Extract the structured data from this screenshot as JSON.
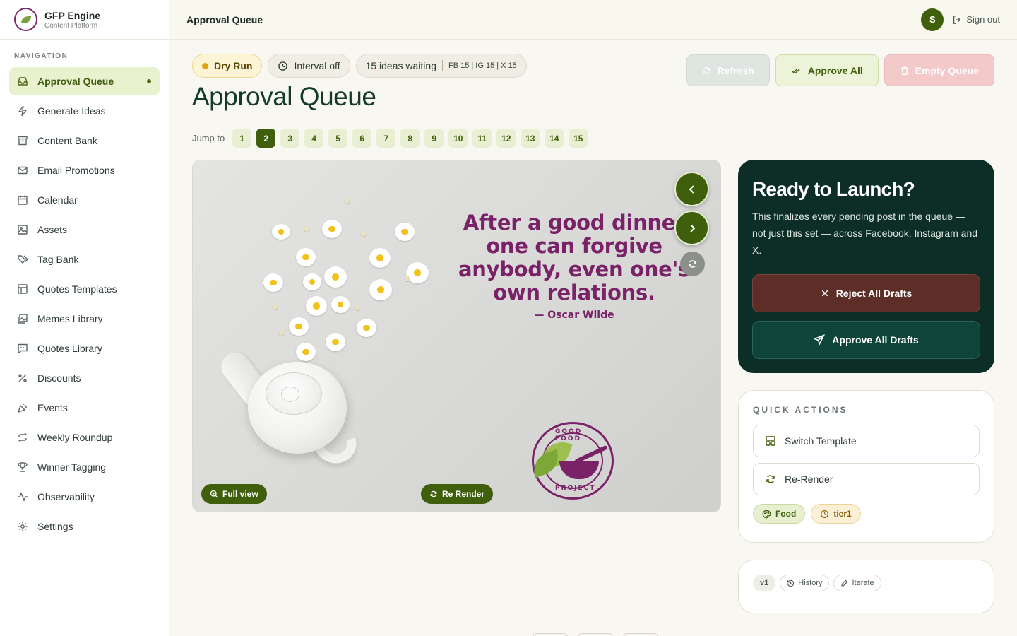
{
  "brand": {
    "name": "GFP Engine",
    "subtitle": "Content Platform"
  },
  "sidebar": {
    "section_label": "NAVIGATION",
    "items": [
      {
        "label": "Approval Queue",
        "icon": "inbox-icon",
        "active": true
      },
      {
        "label": "Generate Ideas",
        "icon": "lightning-icon"
      },
      {
        "label": "Content Bank",
        "icon": "archive-icon"
      },
      {
        "label": "Email Promotions",
        "icon": "mail-icon"
      },
      {
        "label": "Calendar",
        "icon": "calendar-icon"
      },
      {
        "label": "Assets",
        "icon": "image-icon"
      },
      {
        "label": "Tag Bank",
        "icon": "tags-icon"
      },
      {
        "label": "Quotes Templates",
        "icon": "layout-icon"
      },
      {
        "label": "Memes Library",
        "icon": "images-icon"
      },
      {
        "label": "Quotes Library",
        "icon": "message-quote-icon"
      },
      {
        "label": "Discounts",
        "icon": "percent-icon"
      },
      {
        "label": "Events",
        "icon": "party-popper-icon"
      },
      {
        "label": "Weekly Roundup",
        "icon": "repeat-icon"
      },
      {
        "label": "Winner Tagging",
        "icon": "trophy-icon"
      },
      {
        "label": "Observability",
        "icon": "activity-icon"
      },
      {
        "label": "Settings",
        "icon": "gear-icon"
      }
    ]
  },
  "topbar": {
    "title": "Approval Queue",
    "avatar_initial": "S",
    "signout_label": "Sign out"
  },
  "status": {
    "dry_run": "Dry Run",
    "interval": "Interval off",
    "ideas_waiting": "15 ideas waiting",
    "platform_counts": "FB 15 | IG 15 | X 15"
  },
  "header_buttons": {
    "refresh": "Refresh",
    "approve_all": "Approve All",
    "empty_queue": "Empty Queue"
  },
  "page_title": "Approval Queue",
  "jump": {
    "label": "Jump to",
    "pages": [
      "1",
      "2",
      "3",
      "4",
      "5",
      "6",
      "7",
      "8",
      "9",
      "10",
      "11",
      "12",
      "13",
      "14",
      "15"
    ],
    "current": "2"
  },
  "preview": {
    "quote": "After a good dinner one can forgive anybody, even one's own relations.",
    "author": "— Oscar Wilde",
    "logo_top": "GOOD FOOD",
    "logo_bottom": "PROJECT",
    "full_view_label": "Full view",
    "re_render_label": "Re Render",
    "quote_color": "#7a2268"
  },
  "launch": {
    "title": "Ready to Launch?",
    "description": "This finalizes every pending post in the queue — not just this set — across Facebook, Instagram and X.",
    "reject_label": "Reject All Drafts",
    "approve_label": "Approve All Drafts"
  },
  "quick_actions": {
    "label": "QUICK ACTIONS",
    "switch_template": "Switch Template",
    "re_render": "Re-Render",
    "tags": [
      {
        "label": "Food",
        "icon": "palette-icon"
      },
      {
        "label": "tier1",
        "icon": "clock-icon"
      }
    ]
  },
  "version": {
    "current": "v1",
    "history_label": "History",
    "iterate_label": "Iterate"
  },
  "colors": {
    "primary": "#3f5f0d",
    "dark_card": "#0d2e27",
    "reject": "#5c2e27",
    "dry_run": "#e2a20f"
  }
}
